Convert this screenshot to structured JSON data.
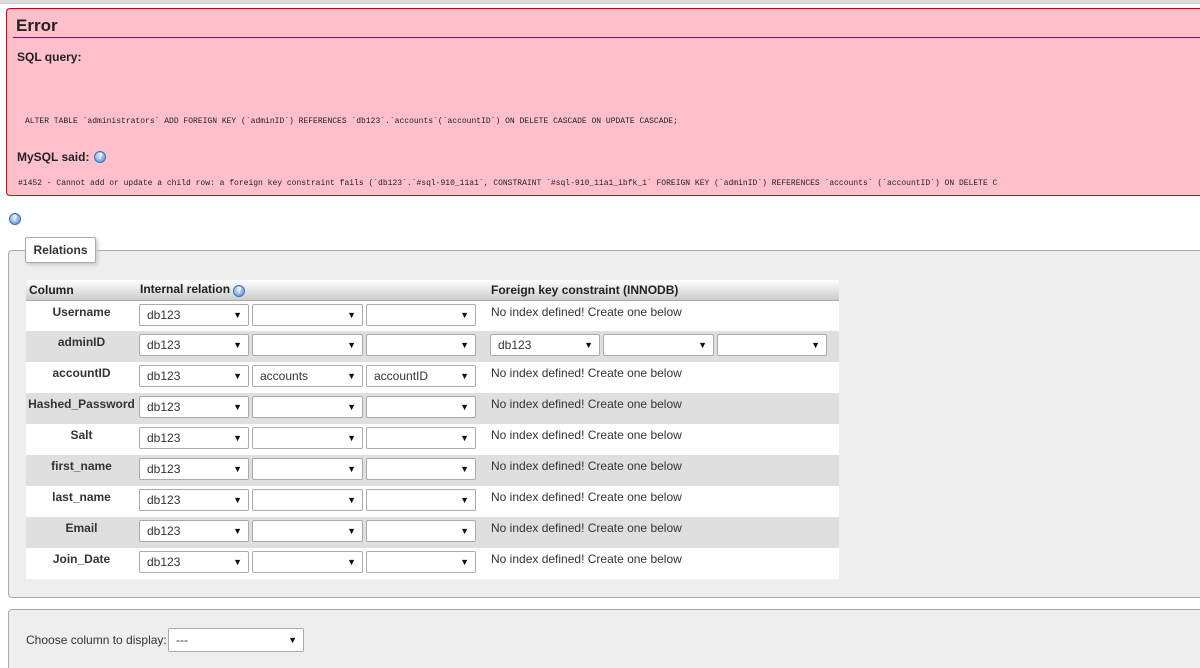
{
  "error": {
    "title": "Error",
    "sql_label": "SQL query:",
    "sql_text": "ALTER TABLE `administrators` ADD  FOREIGN KEY (`adminID`) REFERENCES `db123`.`accounts`(`accountID`) ON DELETE CASCADE ON UPDATE CASCADE;",
    "mysql_said_label": "MySQL said:",
    "mysql_said_text": "#1452 - Cannot add or update a child row: a foreign key constraint fails (`db123`.`#sql-910_11a1`, CONSTRAINT `#sql-910_11a1_ibfk_1` FOREIGN KEY (`adminID`) REFERENCES `accounts` (`accountID`) ON DELETE C"
  },
  "relations": {
    "legend": "Relations",
    "headers": {
      "column": "Column",
      "internal_relation": "Internal relation",
      "foreign_key": "Foreign key constraint (INNODB)"
    },
    "rows": [
      {
        "column": "Username",
        "db": "db123",
        "table": "",
        "field": "",
        "fk_text": "No index defined! Create one below"
      },
      {
        "column": "adminID",
        "db": "db123",
        "table": "",
        "field": "",
        "fk_db": "db123",
        "fk_table": "",
        "fk_field": ""
      },
      {
        "column": "accountID",
        "db": "db123",
        "table": "accounts",
        "field": "accountID",
        "fk_text": "No index defined! Create one below"
      },
      {
        "column": "Hashed_Password",
        "db": "db123",
        "table": "",
        "field": "",
        "fk_text": "No index defined! Create one below"
      },
      {
        "column": "Salt",
        "db": "db123",
        "table": "",
        "field": "",
        "fk_text": "No index defined! Create one below"
      },
      {
        "column": "first_name",
        "db": "db123",
        "table": "",
        "field": "",
        "fk_text": "No index defined! Create one below"
      },
      {
        "column": "last_name",
        "db": "db123",
        "table": "",
        "field": "",
        "fk_text": "No index defined! Create one below"
      },
      {
        "column": "Email",
        "db": "db123",
        "table": "",
        "field": "",
        "fk_text": "No index defined! Create one below"
      },
      {
        "column": "Join_Date",
        "db": "db123",
        "table": "",
        "field": "",
        "fk_text": "No index defined! Create one below"
      }
    ]
  },
  "display": {
    "label": "Choose column to display:",
    "value": "---"
  },
  "icons": {
    "help": "help-icon",
    "dropdown": "chevron-down-icon"
  },
  "colors": {
    "error_bg": "#ffc0cb",
    "error_border": "#cc0000",
    "panel_bg": "#eeeeee"
  }
}
